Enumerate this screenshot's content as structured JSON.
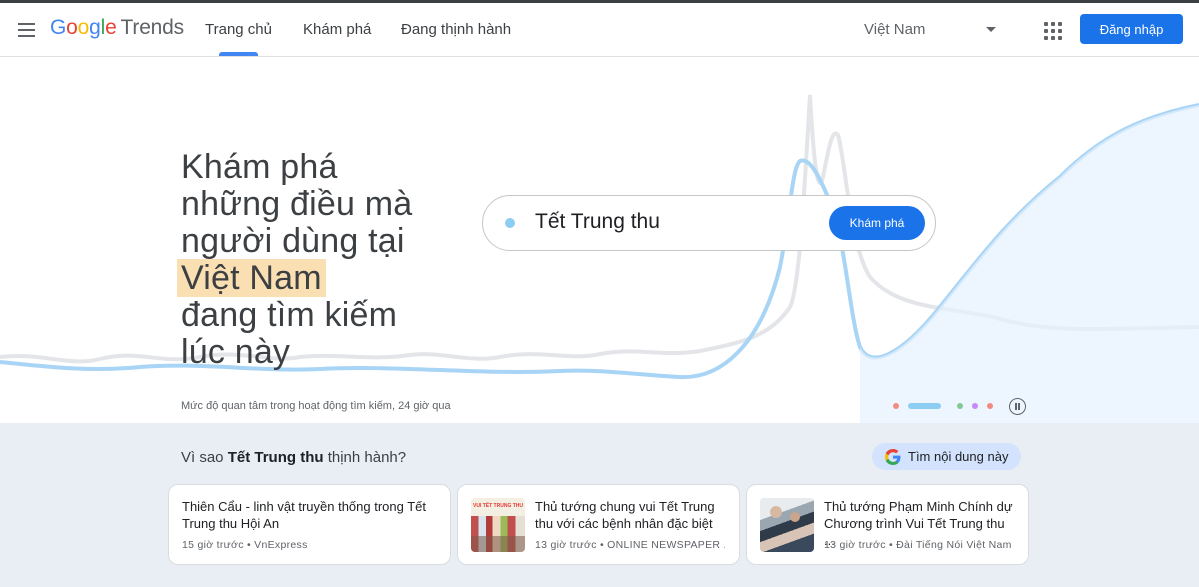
{
  "header": {
    "logo_google": "Google",
    "logo_product": "Trends",
    "nav": [
      "Trang chủ",
      "Khám phá",
      "Đang thịnh hành"
    ],
    "active_nav": "Trang chủ",
    "region": "Việt Nam",
    "signin_label": "Đăng nhập"
  },
  "hero": {
    "headline_lines": [
      "Khám phá",
      "những điều mà",
      "người dùng tại"
    ],
    "highlight": "Việt Nam",
    "headline_tail": [
      "đang tìm kiếm",
      "lúc này"
    ],
    "search_term": "Tết Trung thu",
    "explore_label": "Khám phá",
    "caption": "Mức độ quan tâm trong hoạt động tìm kiếm, 24 giờ qua",
    "carousel_colors": [
      "#f28b82",
      "#8ecdf2",
      "#81c995",
      "#c58af9",
      "#f28b82"
    ],
    "active_slide": 2
  },
  "why": {
    "prefix": "Vì sao",
    "term": "Tết Trung thu",
    "suffix": "thịnh hành?",
    "find_label": "Tìm nội dung này"
  },
  "articles": [
    {
      "title": "Thiên Cẩu - linh vật truyền thống trong Tết Trung thu Hội An",
      "time": "15 giờ trước",
      "source": "VnExpress"
    },
    {
      "title": "Thủ tướng chung vui Tết Trung thu với các bệnh nhân đặc biệt",
      "time": "13 giờ trước",
      "source": "ONLINE NEWSPAPER ...",
      "thumb_text": "VUI TẾT TRUNG THU"
    },
    {
      "title": "Thủ tướng Phạm Minh Chính dự Chương trình Vui Tết Trung thu ...",
      "time": "13 giờ trước",
      "source": "Đài Tiếng Nói Việt Nam"
    }
  ],
  "meta_separator": "•"
}
